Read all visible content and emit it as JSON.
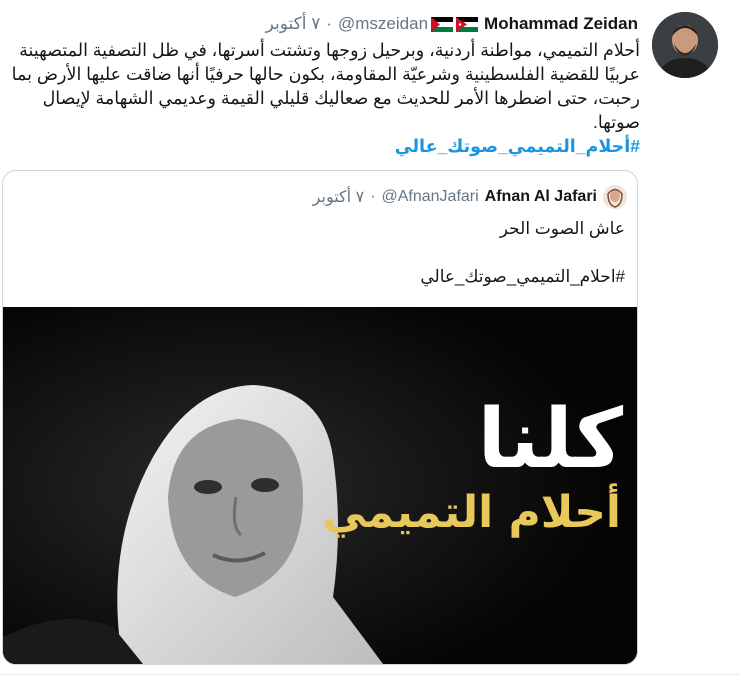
{
  "tweet": {
    "author_name": "Mohammad Zeidan",
    "handle": "@mszeidan",
    "separator": "·",
    "date": "٧ أكتوبر",
    "text": "أحلام التميمي، مواطنة أردنية، وبرحيل زوجها وتشتت أسرتها، في ظل التصفية المتصهينة عربيًا للقضية الفلسطينية وشرعيّة المقاومة، بكون حالها حرفيًا أنها ضاقت عليها الأرض بما رحبت، حتى اضطرها الأمر للحديث مع صعاليك قليلي القيمة وعديمي الشهامة لإيصال صوتها.",
    "hashtag": "#أحلام_التميمي_صوتك_عالي",
    "flags": [
      "jordan-flag",
      "palestine-flag"
    ]
  },
  "quote": {
    "author_name": "Afnan Al Jafari",
    "handle": "@AfnanJafari",
    "separator": "·",
    "date": "٧ أكتوبر",
    "line1": "عاش الصوت الحر",
    "hashtag": "#احلام_التميمي_صوتك_عالي",
    "media": {
      "overlay_line1": "كلنا",
      "overlay_line2": "أحلام التميمي"
    }
  },
  "colors": {
    "link": "#1b95e0",
    "muted": "#657786",
    "border": "#ccd6dd",
    "gold": "#e8c85a"
  }
}
